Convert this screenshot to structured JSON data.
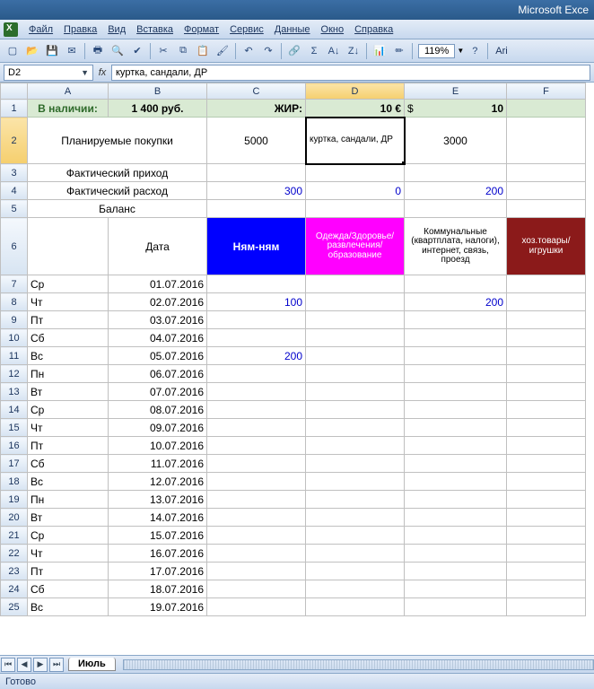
{
  "app": {
    "title": "Microsoft Exce"
  },
  "menu": [
    "Файл",
    "Правка",
    "Вид",
    "Вставка",
    "Формат",
    "Сервис",
    "Данные",
    "Окно",
    "Справка"
  ],
  "toolbar": {
    "zoom": "119%",
    "font_fragment": "Ari"
  },
  "namebox": "D2",
  "formula": "куртка, сандали, ДР",
  "columns": [
    "A",
    "B",
    "C",
    "D",
    "E",
    "F"
  ],
  "row_heights": {
    "2": 52,
    "6": 64
  },
  "row1": {
    "A": "В наличии:",
    "B": "1 400 руб.",
    "C": "ЖИР:",
    "D": "10 €",
    "E_prefix": "$",
    "E_val": "10"
  },
  "row2": {
    "AB": "Планируемые покупки",
    "C": "5000",
    "D": "куртка, сандали, ДР",
    "E": "3000"
  },
  "row3": {
    "AB": "Фактический приход"
  },
  "row4": {
    "AB": "Фактический расход",
    "C": "300",
    "D": "0",
    "E": "200"
  },
  "row5": {
    "AB": "Баланс"
  },
  "row6": {
    "B": "Дата",
    "C": "Ням-ням",
    "D": "Одежда/Здоровье/развлечения/образование",
    "E": "Коммунальные (квартплата, налоги), интернет, связь, проезд",
    "F": "хоз.товары/игрушки"
  },
  "data_rows": [
    {
      "n": 7,
      "A": "Ср",
      "B": "01.07.2016"
    },
    {
      "n": 8,
      "A": "Чт",
      "B": "02.07.2016",
      "C": "100",
      "E": "200"
    },
    {
      "n": 9,
      "A": "Пт",
      "B": "03.07.2016"
    },
    {
      "n": 10,
      "A": "Сб",
      "B": "04.07.2016"
    },
    {
      "n": 11,
      "A": "Вс",
      "B": "05.07.2016",
      "C": "200"
    },
    {
      "n": 12,
      "A": "Пн",
      "B": "06.07.2016"
    },
    {
      "n": 13,
      "A": "Вт",
      "B": "07.07.2016"
    },
    {
      "n": 14,
      "A": "Ср",
      "B": "08.07.2016"
    },
    {
      "n": 15,
      "A": "Чт",
      "B": "09.07.2016"
    },
    {
      "n": 16,
      "A": "Пт",
      "B": "10.07.2016"
    },
    {
      "n": 17,
      "A": "Сб",
      "B": "11.07.2016"
    },
    {
      "n": 18,
      "A": "Вс",
      "B": "12.07.2016"
    },
    {
      "n": 19,
      "A": "Пн",
      "B": "13.07.2016"
    },
    {
      "n": 20,
      "A": "Вт",
      "B": "14.07.2016"
    },
    {
      "n": 21,
      "A": "Ср",
      "B": "15.07.2016"
    },
    {
      "n": 22,
      "A": "Чт",
      "B": "16.07.2016"
    },
    {
      "n": 23,
      "A": "Пт",
      "B": "17.07.2016"
    },
    {
      "n": 24,
      "A": "Сб",
      "B": "18.07.2016"
    },
    {
      "n": 25,
      "A": "Вс",
      "B": "19.07.2016"
    }
  ],
  "sheet_tab": "Июль",
  "status": "Готово"
}
